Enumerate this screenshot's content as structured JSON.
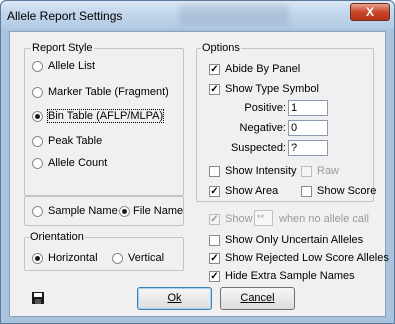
{
  "window": {
    "title": "Allele Report Settings",
    "close_label": "X"
  },
  "report_style": {
    "title": "Report Style",
    "options": [
      "Allele List",
      "Marker Table (Fragment)",
      "Bin Table (AFLP/MLPA)",
      "Peak Table",
      "Allele Count"
    ],
    "selected": "Bin Table (AFLP/MLPA)"
  },
  "sample_by": {
    "sample_name": "Sample Name",
    "file_name": "File Name",
    "selected": "File Name"
  },
  "orientation": {
    "title": "Orientation",
    "horizontal": "Horizontal",
    "vertical": "Vertical",
    "selected": "Horizontal"
  },
  "options": {
    "title": "Options",
    "abide_by_panel": "Abide By Panel",
    "show_type_symbol": "Show Type Symbol",
    "positive_label": "Positive:",
    "positive_value": "1",
    "negative_label": "Negative:",
    "negative_value": "0",
    "suspected_label": "Suspected:",
    "suspected_value": "?",
    "show_intensity": "Show Intensity",
    "raw": "Raw",
    "show_area": "Show Area",
    "show_score": "Show Score"
  },
  "extra": {
    "show_label": "Show",
    "show_value": "**",
    "when_no_call": "when no allele call",
    "only_uncertain": "Show Only Uncertain Alleles",
    "rejected_low_score": "Show Rejected Low Score Alleles",
    "hide_extra_names": "Hide Extra Sample Names"
  },
  "buttons": {
    "ok": "Ok",
    "cancel": "Cancel"
  },
  "icons": {
    "save": "floppy-disk-icon"
  }
}
